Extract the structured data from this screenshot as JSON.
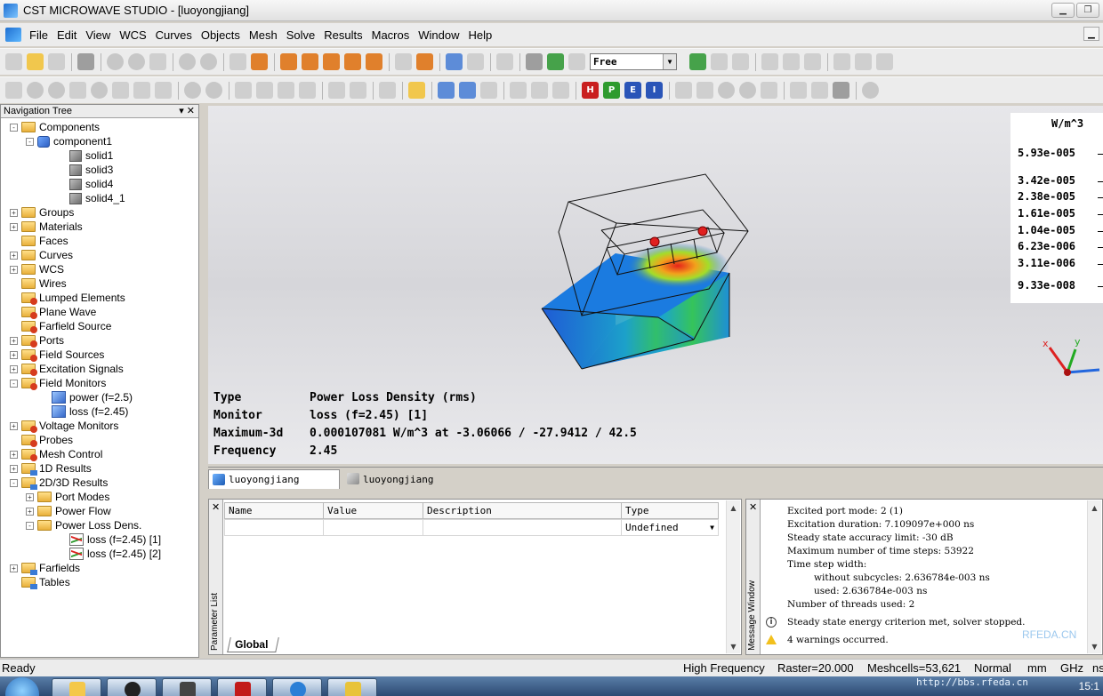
{
  "window": {
    "title": "CST MICROWAVE STUDIO - [luoyongjiang]"
  },
  "menu": [
    "File",
    "Edit",
    "View",
    "WCS",
    "Curves",
    "Objects",
    "Mesh",
    "Solve",
    "Results",
    "Macros",
    "Window",
    "Help"
  ],
  "toolbar": {
    "mode_select": "Free",
    "btn_h": "H",
    "btn_p": "P",
    "btn_e": "E",
    "btn_i": "I"
  },
  "nav_tree": {
    "title": "Navigation Tree",
    "items": [
      {
        "label": "Components",
        "icon": "folder-icon"
      },
      {
        "label": "component1",
        "icon": "component-icon"
      },
      {
        "label": "solid1",
        "icon": "solid-icon"
      },
      {
        "label": "solid3",
        "icon": "solid-icon"
      },
      {
        "label": "solid4",
        "icon": "solid-icon"
      },
      {
        "label": "solid4_1",
        "icon": "solid-icon"
      },
      {
        "label": "Groups",
        "icon": "folder-icon"
      },
      {
        "label": "Materials",
        "icon": "folder-icon"
      },
      {
        "label": "Faces",
        "icon": "folder-icon"
      },
      {
        "label": "Curves",
        "icon": "folder-icon"
      },
      {
        "label": "WCS",
        "icon": "folder-icon"
      },
      {
        "label": "Wires",
        "icon": "folder-icon"
      },
      {
        "label": "Lumped Elements",
        "icon": "folder-gear-icon"
      },
      {
        "label": "Plane Wave",
        "icon": "folder-gear-icon"
      },
      {
        "label": "Farfield Source",
        "icon": "folder-gear-icon"
      },
      {
        "label": "Ports",
        "icon": "folder-gear-icon"
      },
      {
        "label": "Field Sources",
        "icon": "folder-gear-icon"
      },
      {
        "label": "Excitation Signals",
        "icon": "folder-gear-icon"
      },
      {
        "label": "Field Monitors",
        "icon": "folder-gear-icon"
      },
      {
        "label": "power (f=2.5)",
        "icon": "monitor-icon"
      },
      {
        "label": "loss (f=2.45)",
        "icon": "monitor-icon"
      },
      {
        "label": "Voltage Monitors",
        "icon": "folder-gear-icon"
      },
      {
        "label": "Probes",
        "icon": "folder-gear-icon"
      },
      {
        "label": "Mesh Control",
        "icon": "folder-gear-icon"
      },
      {
        "label": "1D Results",
        "icon": "folder-chart-icon"
      },
      {
        "label": "2D/3D Results",
        "icon": "folder-chart-icon"
      },
      {
        "label": "Port Modes",
        "icon": "folder-icon"
      },
      {
        "label": "Power Flow",
        "icon": "folder-icon"
      },
      {
        "label": "Power Loss Dens.",
        "icon": "folder-icon"
      },
      {
        "label": "loss (f=2.45) [1]",
        "icon": "result-icon"
      },
      {
        "label": "loss (f=2.45) [2]",
        "icon": "result-icon"
      },
      {
        "label": "Farfields",
        "icon": "folder-chart-icon"
      },
      {
        "label": "Tables",
        "icon": "folder-chart-icon"
      }
    ]
  },
  "viewport": {
    "legend": {
      "unit": "W/m^3",
      "values": [
        "5.93e-005",
        "3.42e-005",
        "2.38e-005",
        "1.61e-005",
        "1.04e-005",
        "6.23e-006",
        "3.11e-006",
        "9.33e-008"
      ]
    },
    "info": [
      {
        "key": "Type",
        "value": "Power Loss Density (rms)"
      },
      {
        "key": "Monitor",
        "value": "loss (f=2.45) [1]"
      },
      {
        "key": "Maximum-3d",
        "value": "0.000107081 W/m^3 at -3.06066 / -27.9412 / 42.5"
      },
      {
        "key": "Frequency",
        "value": "2.45"
      }
    ],
    "axes": {
      "x": "x",
      "y": "y"
    }
  },
  "doc_tabs": [
    "luoyongjiang",
    "luoyongjiang"
  ],
  "param_list": {
    "title": "Parameter List",
    "columns": [
      "Name",
      "Value",
      "Description",
      "Type"
    ],
    "new_row_type": "Undefined",
    "tab": "Global"
  },
  "messages": {
    "title": "Message Window",
    "lines": [
      "Excited port mode: 2 (1)",
      "Excitation duration: 7.109097e+000 ns",
      "Steady state accuracy limit: -30 dB",
      "Maximum number of time steps: 53922",
      "Time step width:",
      "without subcycles: 2.636784e-003 ns",
      "used: 2.636784e-003 ns",
      "Number of threads used: 2",
      "Steady state energy criterion met, solver stopped.",
      "4 warnings occurred."
    ],
    "watermark": "RFEDA.CN"
  },
  "status": {
    "left": "Ready",
    "solver": "High Frequency",
    "raster": "Raster=20.000",
    "meshcells": "Meshcells=53,621",
    "mode": "Normal",
    "length_unit": "mm",
    "freq_unit": "GHz",
    "time_unit": "ns"
  },
  "taskbar": {
    "url": "http://bbs.rfeda.cn",
    "clock": "15:1"
  }
}
